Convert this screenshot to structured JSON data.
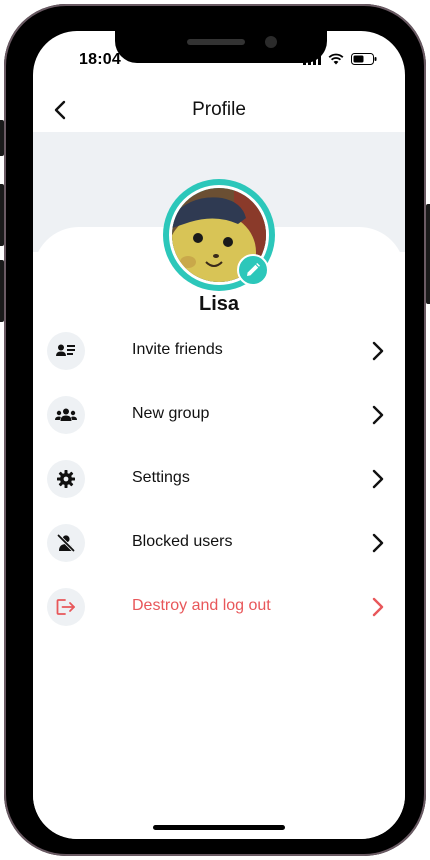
{
  "status": {
    "time": "18:04"
  },
  "header": {
    "title": "Profile"
  },
  "profile": {
    "name": "Lisa"
  },
  "menu": [
    {
      "label": "Invite friends",
      "icon": "contact-card-icon"
    },
    {
      "label": "New group",
      "icon": "group-icon"
    },
    {
      "label": "Settings",
      "icon": "gear-icon"
    },
    {
      "label": "Blocked users",
      "icon": "blocked-user-icon"
    },
    {
      "label": "Destroy and log out",
      "icon": "logout-icon",
      "color": "#e8575a"
    }
  ],
  "colors": {
    "accent": "#2cc7ba",
    "danger": "#e8575a",
    "cover": "#eef1f4"
  }
}
